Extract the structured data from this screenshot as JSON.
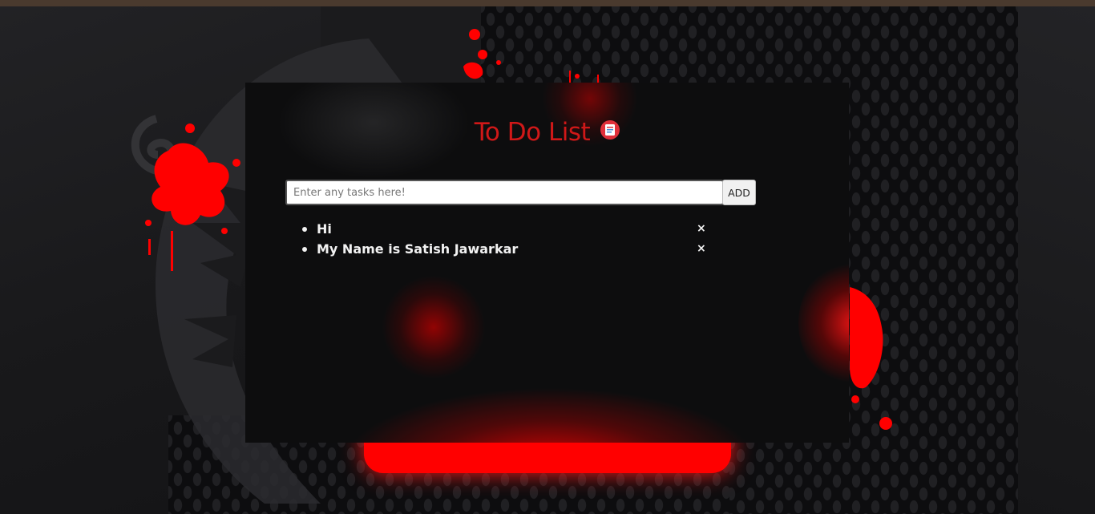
{
  "app": {
    "title": "To Do List",
    "title_icon": "notepad-icon",
    "accent_color": "#d01818"
  },
  "input": {
    "placeholder": "Enter any tasks here!",
    "value": ""
  },
  "add_button": {
    "label": "ADD"
  },
  "tasks": [
    {
      "text": "Hi",
      "delete_label": "×"
    },
    {
      "text": "My Name is Satish Jawarkar",
      "delete_label": "×"
    }
  ]
}
